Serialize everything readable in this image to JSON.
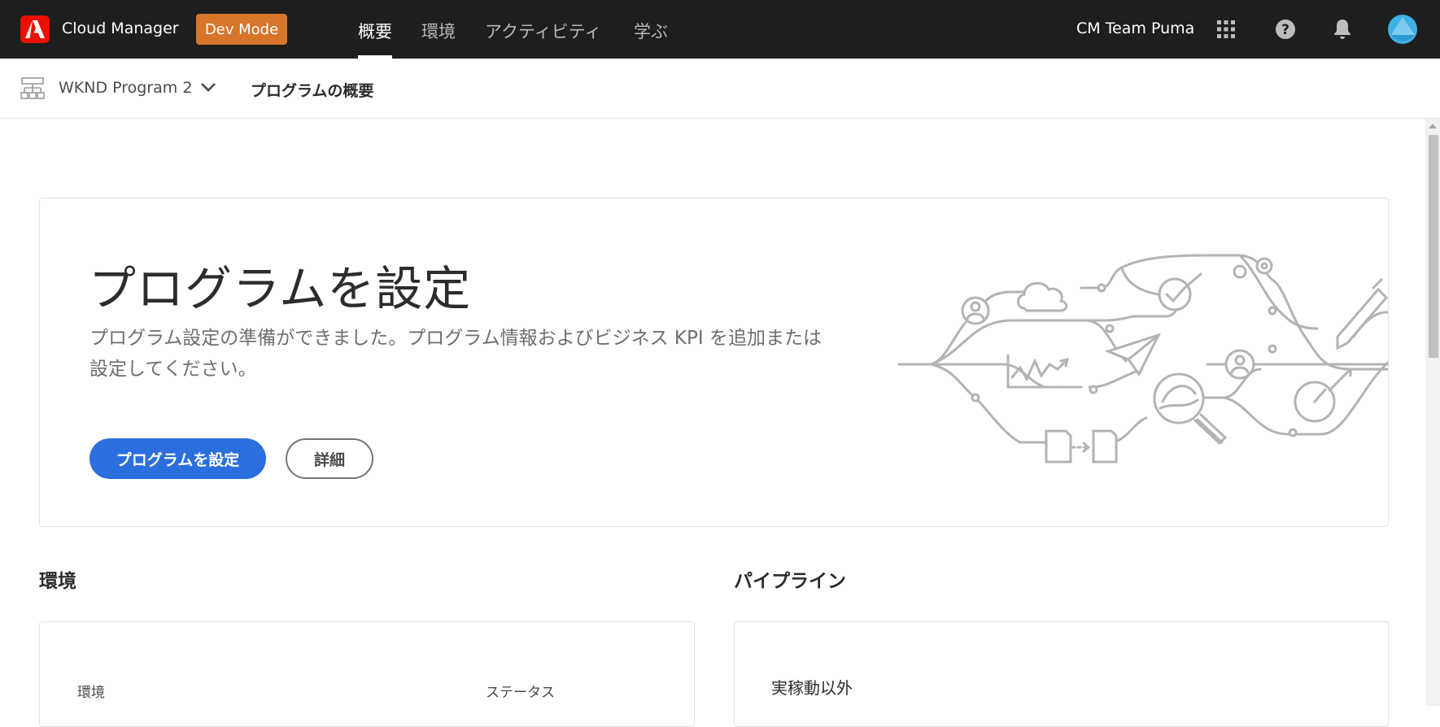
{
  "header": {
    "app_name": "Cloud Manager",
    "dev_mode_label": "Dev Mode",
    "nav": [
      {
        "label": "概要",
        "active": true
      },
      {
        "label": "環境",
        "active": false
      },
      {
        "label": "アクティビティ",
        "active": false
      },
      {
        "label": "学ぶ",
        "active": false
      }
    ],
    "org_name": "CM Team Puma",
    "icons": [
      "adobe-logo-icon",
      "app-grid-icon",
      "help-icon",
      "bell-icon",
      "avatar"
    ]
  },
  "subheader": {
    "program_name": "WKND Program 2",
    "page_title": "プログラムの概要"
  },
  "hero": {
    "title": "プログラムを設定",
    "description": "プログラム設定の準備ができました。プログラム情報およびビジネス KPI を追加または設定してください。",
    "primary_button": "プログラムを設定",
    "secondary_button": "詳細"
  },
  "environments": {
    "title": "環境",
    "columns": [
      "環境",
      "ステータス"
    ]
  },
  "pipelines": {
    "title": "パイプライン",
    "first_label": "実稼動以外"
  },
  "colors": {
    "topbar": "#1e1e1e",
    "dev_mode": "#d7762b",
    "primary": "#2b6fde",
    "adobe_red": "#eb1000"
  }
}
